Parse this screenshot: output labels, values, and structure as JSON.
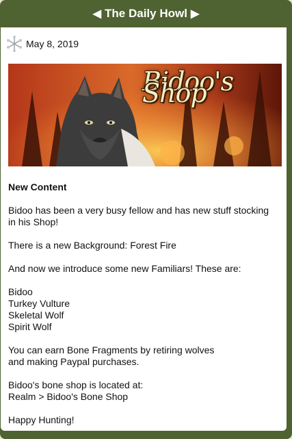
{
  "header": {
    "title": "The Daily Howl",
    "prev_arrow": "◀",
    "next_arrow": "▶"
  },
  "post": {
    "date": "May 8, 2019",
    "banner_text": "Bidoo's Shop",
    "heading": "New Content",
    "intro": "Bidoo has been a very busy fellow and has new stuff stocking in his Shop!",
    "background_line": "There is a new Background: Forest Fire",
    "familiars_intro": "And now we introduce some new Familiars! These are:",
    "familiars": [
      "Bidoo",
      "Turkey Vulture",
      "Skeletal Wolf",
      "Spirit Wolf"
    ],
    "bone_line_1": "You can earn Bone Fragments by retiring wolves",
    "bone_line_2": "and making Paypal purchases.",
    "location_line_1": "Bidoo's bone shop is located at:",
    "location_line_2": "Realm > Bidoo's Bone Shop",
    "signoff": "Happy Hunting!"
  },
  "colors": {
    "header_bg": "#4f6231",
    "header_text": "#ffffff",
    "content_bg": "#ffffff",
    "page_bg": "#e8e3cf"
  }
}
